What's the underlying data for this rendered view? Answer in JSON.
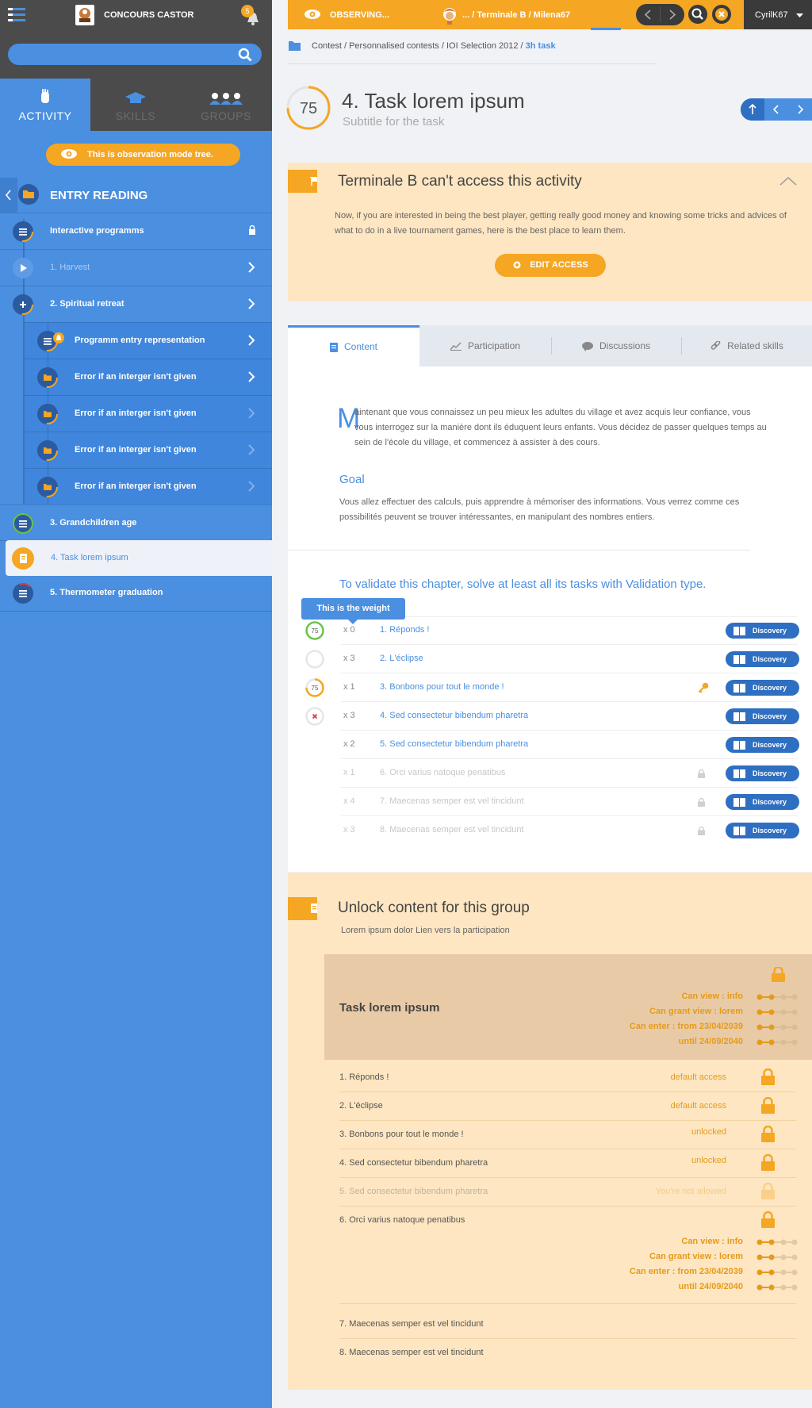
{
  "sidebar": {
    "brand": "CONCOURS CASTOR",
    "notifications": "5",
    "tabs": [
      {
        "label": "ACTIVITY"
      },
      {
        "label": "SKILLS"
      },
      {
        "label": "GROUPS"
      }
    ],
    "observation_notice": "This is observation mode tree.",
    "section_title": "ENTRY READING",
    "items": [
      {
        "label": "Interactive programms"
      },
      {
        "label": "1. Harvest"
      },
      {
        "label": "2. Spiritual retreat"
      },
      {
        "label": "Programm entry representation"
      },
      {
        "label": "Error if an interger isn't given"
      },
      {
        "label": "Error if an interger isn't given"
      },
      {
        "label": "Error if an interger isn't given"
      },
      {
        "label": "Error if an interger isn't given"
      },
      {
        "label": "3. Grandchildren age"
      },
      {
        "label": "4. Task lorem ipsum"
      },
      {
        "label": "5. Thermometer graduation"
      }
    ]
  },
  "topbar": {
    "observing": "OBSERVING...",
    "breadcrumb": "... / Terminale B  /  Milena67",
    "user": "CyrilK67"
  },
  "breadcrumb": {
    "path": "Contest / Personnalised contests / IOI Selection 2012 / ",
    "current": "3h task"
  },
  "header": {
    "score": "75",
    "title": "4. Task lorem ipsum",
    "subtitle": "Subtitle for the task"
  },
  "access": {
    "title": "Terminale B can't access this activity",
    "text": "Now, if you are interested in being the best player, getting really good money and knowing some tricks and advices of what to do in a live tournament games, here is the best place to learn them.",
    "button": "EDIT ACCESS"
  },
  "content_tabs": [
    {
      "label": "Content"
    },
    {
      "label": "Participation"
    },
    {
      "label": "Discussions"
    },
    {
      "label": "Related skills"
    }
  ],
  "content": {
    "dropcap": "M",
    "intro_first": "aintenant que vous connaissez un peu mieux les adultes du village et avez acquis leur confiance, vous",
    "intro_rest": "vous interrogez sur la manière dont ils éduquent leurs enfants. Vous décidez de passer quelques temps au sein de l'école du village, et commencez à assister à des cours.",
    "goal_title": "Goal",
    "goal_text": "Vous allez effectuer des calculs, puis apprendre à mémoriser des informations. Vous verrez comme ces possibilités peuvent se trouver intéressantes, en manipulant des nombres entiers.",
    "validate_title": "To validate this chapter, solve at least all its tasks with Validation type.",
    "tooltip": "This is the weight",
    "discovery_label": "Discovery",
    "tasks": [
      {
        "weight": "x 0",
        "title": "1. Réponds !",
        "score": "75"
      },
      {
        "weight": "x 3",
        "title": "2. L'éclipse"
      },
      {
        "weight": "x 1",
        "title": "3. Bonbons pour tout le monde !",
        "score": "75"
      },
      {
        "weight": "x 3",
        "title": "4. Sed consectetur bibendum pharetra"
      },
      {
        "weight": "x 2",
        "title": "5. Sed consectetur bibendum pharetra"
      },
      {
        "weight": "x 1",
        "title": "6. Orci varius natoque penatibus"
      },
      {
        "weight": "x 4",
        "title": "7. Maecenas semper est vel tincidunt"
      },
      {
        "weight": "x 3",
        "title": "8. Maecenas semper est vel tincidunt"
      }
    ]
  },
  "unlock": {
    "title": "Unlock content for this group",
    "subtitle": "Lorem ipsum dolor Lien vers la participation",
    "box_title": "Task lorem ipsum",
    "permissions": [
      "Can view : info",
      "Can grant view : lorem",
      "Can enter : from 23/04/2039",
      "until  24/09/2040"
    ],
    "rows": [
      {
        "title": "1. Réponds !",
        "status": "default access"
      },
      {
        "title": "2. L'éclipse",
        "status": "default access"
      },
      {
        "title": "3. Bonbons pour tout le monde !",
        "status": "unlocked"
      },
      {
        "title": "4. Sed consectetur bibendum pharetra",
        "status": "unlocked"
      },
      {
        "title": "5. Sed consectetur bibendum pharetra",
        "status": "You're not allowed"
      },
      {
        "title": "6. Orci varius natoque penatibus",
        "status": ""
      },
      {
        "title": "7. Maecenas semper est vel tincidunt",
        "status": ""
      },
      {
        "title": "8. Maecenas semper est vel tincidunt",
        "status": ""
      }
    ]
  },
  "colors": {
    "accent_orange": "#f5a623",
    "accent_blue": "#4a8fe0",
    "dark": "#4b4b4b"
  }
}
